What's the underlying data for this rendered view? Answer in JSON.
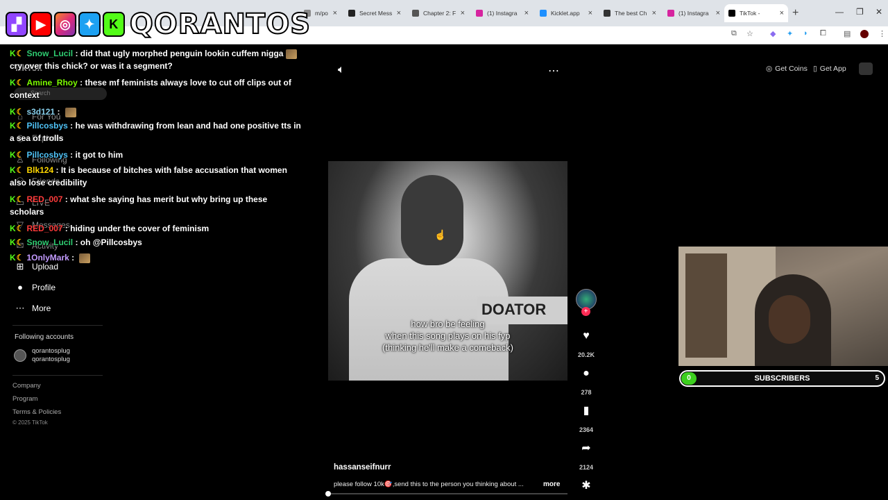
{
  "browser": {
    "tabs": [
      {
        "label": "m/po",
        "color": "#888888"
      },
      {
        "label": "Secret Mess",
        "color": "#222222"
      },
      {
        "label": "Chapter 2: F",
        "color": "#555555"
      },
      {
        "label": "(1) Instagra",
        "color": "#d6249f"
      },
      {
        "label": "Kicklet.app",
        "color": "#1e90ff"
      },
      {
        "label": "The best Ch",
        "color": "#333333"
      },
      {
        "label": "(1) Instagra",
        "color": "#d6249f"
      },
      {
        "label": "TikTok -",
        "color": "#000000",
        "active": true
      }
    ]
  },
  "stream_banner": {
    "logos": [
      "twitch",
      "youtube",
      "instagram",
      "twitter",
      "kick"
    ],
    "brand": "QORANTOS"
  },
  "sidebar": {
    "logo": "TikTok",
    "search_placeholder": "Search",
    "items": [
      {
        "label": "For You",
        "icon": "home-icon"
      },
      {
        "label": "Explore",
        "icon": "compass-icon"
      },
      {
        "label": "Following",
        "icon": "following-icon"
      },
      {
        "label": "Friends",
        "icon": "friends-icon"
      },
      {
        "label": "LIVE",
        "icon": "live-icon"
      },
      {
        "label": "Messages",
        "icon": "messages-icon"
      },
      {
        "label": "Activity",
        "icon": "activity-icon"
      },
      {
        "label": "Upload",
        "icon": "upload-icon"
      },
      {
        "label": "Profile",
        "icon": "profile-icon"
      },
      {
        "label": "More",
        "icon": "more-icon"
      }
    ],
    "following_heading": "Following accounts",
    "following": [
      {
        "name": "qorantosplug",
        "handle": "qorantosplug"
      }
    ],
    "footer_links": [
      "Company",
      "Program",
      "Terms & Policies"
    ],
    "copyright": "© 2025 TikTok"
  },
  "chat": [
    {
      "user": "Snow_Lucil",
      "color": "#2ecc71",
      "text": "did that ugly morphed penguin lookin cuffem nigga",
      "emote": true,
      "cont": "cry over this chick? or was it a segment?"
    },
    {
      "user": "Amine_Rhoy",
      "color": "#7cfc00",
      "text": "these mf feminists always love to cut off clips out of",
      "cont": "context"
    },
    {
      "user": "s3d121",
      "color": "#87ceeb",
      "text": "",
      "emote": true
    },
    {
      "user": "Pillcosbys",
      "color": "#4fc3f7",
      "text": "he was withdrawing from lean and had one positive tts in",
      "cont": "a sea of trolls"
    },
    {
      "user": "Pillcosbys",
      "color": "#4fc3f7",
      "text": "it got to him"
    },
    {
      "user": "Blk124",
      "color": "#ffd700",
      "text": "It is because of bitches with false accusation that women",
      "cont": "also lose credibility"
    },
    {
      "user": "RED_007",
      "color": "#ff3b3b",
      "text": "what she saying has merit but why bring up these",
      "cont": "scholars"
    },
    {
      "user": "RED_007",
      "color": "#ff3b3b",
      "text": "hiding under the cover of feminism"
    },
    {
      "user": "Snow_Lucil",
      "color": "#2ecc71",
      "text": "oh @Pillcosbys"
    },
    {
      "user": "1OnlyMark",
      "color": "#c39bff",
      "text": "",
      "emote": true
    }
  ],
  "video": {
    "caption_lines": [
      "how bro be feeling",
      "when this song plays on his fyp",
      "(thinking he'll make a comeback)"
    ],
    "ad_text": "DOATOR",
    "username": "hassanseifnurr",
    "description": "please follow 10k🎯,send this to the person you thinking about ...",
    "more_label": "more",
    "progress": 0.0
  },
  "top_actions": {
    "get_coins": "Get Coins",
    "get_app": "Get App"
  },
  "actions": {
    "likes": "20.2K",
    "comments": "278",
    "saves": "2364",
    "shares": "2124"
  },
  "subscribers": {
    "current": "0",
    "label": "SUBSCRIBERS",
    "goal": "5",
    "progress": 0
  }
}
